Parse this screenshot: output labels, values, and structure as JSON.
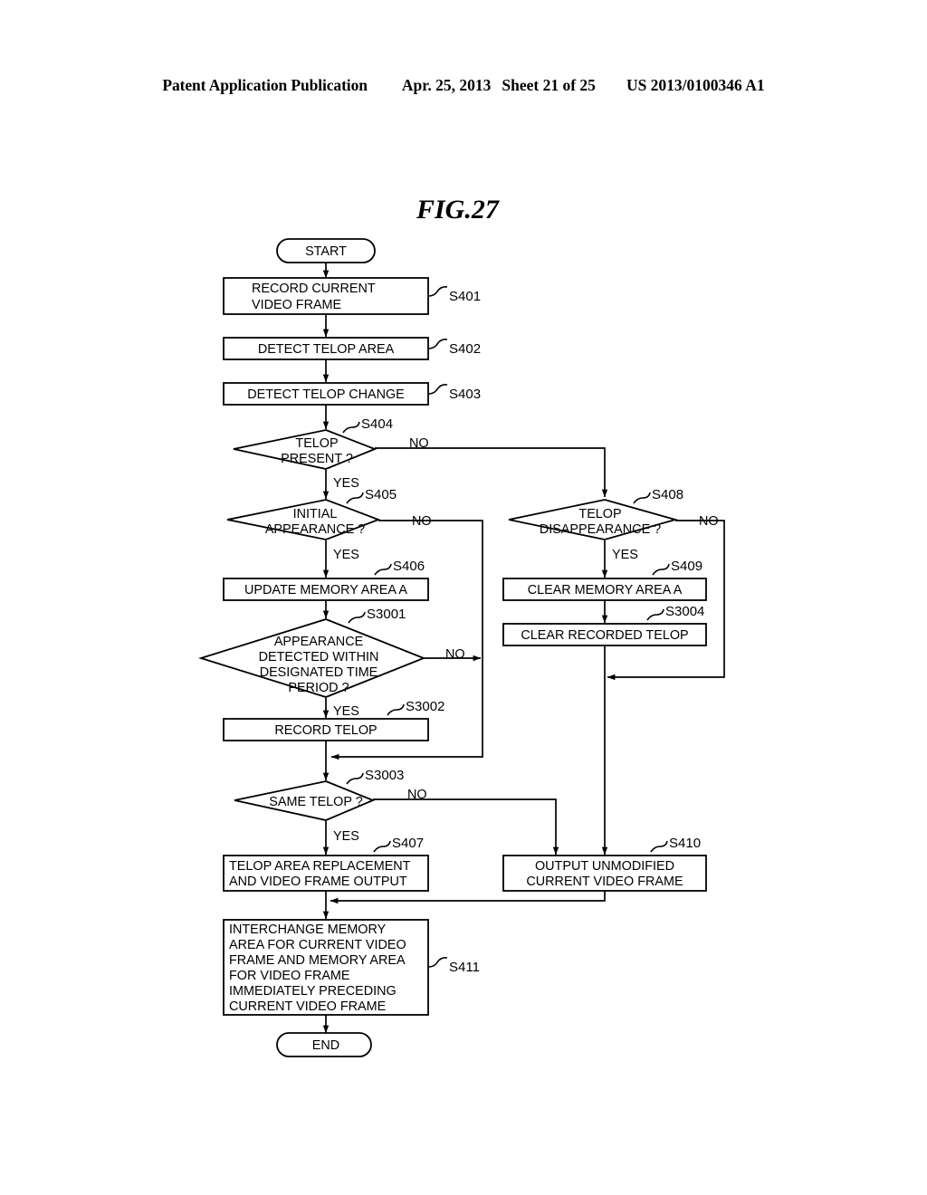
{
  "header": {
    "publication": "Patent Application Publication",
    "date": "Apr. 25, 2013",
    "sheet": "Sheet 21 of 25",
    "docnum": "US 2013/0100346 A1"
  },
  "figure": {
    "title": "FIG.27"
  },
  "flowchart": {
    "terminals": {
      "start": "START",
      "end": "END"
    },
    "nodes": [
      {
        "id": "S401",
        "ref": "S401",
        "type": "process",
        "lines": [
          "RECORD CURRENT",
          "VIDEO FRAME"
        ]
      },
      {
        "id": "S402",
        "ref": "S402",
        "type": "process",
        "lines": [
          "DETECT TELOP AREA"
        ]
      },
      {
        "id": "S403",
        "ref": "S403",
        "type": "process",
        "lines": [
          "DETECT TELOP CHANGE"
        ]
      },
      {
        "id": "S404",
        "ref": "S404",
        "type": "decision",
        "lines": [
          "TELOP",
          "PRESENT ?"
        ]
      },
      {
        "id": "S405",
        "ref": "S405",
        "type": "decision",
        "lines": [
          "INITIAL",
          "APPEARANCE ?"
        ]
      },
      {
        "id": "S406",
        "ref": "S406",
        "type": "process",
        "lines": [
          "UPDATE MEMORY AREA A"
        ]
      },
      {
        "id": "S3001",
        "ref": "S3001",
        "type": "decision",
        "lines": [
          "APPEARANCE",
          "DETECTED WITHIN",
          "DESIGNATED TIME",
          "PERIOD ?"
        ]
      },
      {
        "id": "S3002",
        "ref": "S3002",
        "type": "process",
        "lines": [
          "RECORD TELOP"
        ]
      },
      {
        "id": "S3003",
        "ref": "S3003",
        "type": "decision",
        "lines": [
          "SAME TELOP ?"
        ]
      },
      {
        "id": "S407",
        "ref": "S407",
        "type": "process",
        "lines": [
          "TELOP AREA REPLACEMENT",
          "AND VIDEO FRAME OUTPUT"
        ]
      },
      {
        "id": "S408",
        "ref": "S408",
        "type": "decision",
        "lines": [
          "TELOP",
          "DISAPPEARANCE ?"
        ]
      },
      {
        "id": "S409",
        "ref": "S409",
        "type": "process",
        "lines": [
          "CLEAR MEMORY AREA A"
        ]
      },
      {
        "id": "S3004",
        "ref": "S3004",
        "type": "process",
        "lines": [
          "CLEAR RECORDED TELOP"
        ]
      },
      {
        "id": "S410",
        "ref": "S410",
        "type": "process",
        "lines": [
          "OUTPUT UNMODIFIED",
          "CURRENT VIDEO FRAME"
        ]
      },
      {
        "id": "S411",
        "ref": "S411",
        "type": "process",
        "lines": [
          "INTERCHANGE MEMORY",
          "AREA FOR CURRENT VIDEO",
          "FRAME AND MEMORY AREA",
          "FOR VIDEO FRAME",
          "IMMEDIATELY PRECEDING",
          "CURRENT VIDEO FRAME"
        ]
      }
    ],
    "branch_labels": {
      "yes": "YES",
      "no": "NO"
    },
    "edge_labels": [
      {
        "from": "S404",
        "label": "NO"
      },
      {
        "from": "S404",
        "label": "YES"
      },
      {
        "from": "S405",
        "label": "NO"
      },
      {
        "from": "S405",
        "label": "YES"
      },
      {
        "from": "S3001",
        "label": "NO"
      },
      {
        "from": "S3001",
        "label": "YES"
      },
      {
        "from": "S3003",
        "label": "NO"
      },
      {
        "from": "S3003",
        "label": "YES"
      },
      {
        "from": "S408",
        "label": "NO"
      },
      {
        "from": "S408",
        "label": "YES"
      }
    ]
  },
  "colors": {
    "ink": "#000000",
    "paper": "#ffffff"
  }
}
